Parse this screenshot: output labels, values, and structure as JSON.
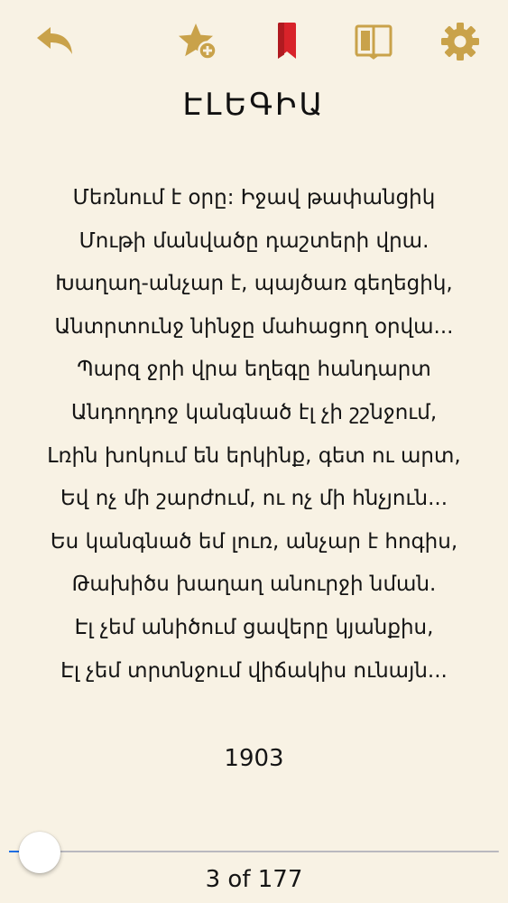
{
  "colors": {
    "background": "#f8f2e4",
    "icon_gold": "#c9a24a",
    "bookmark_red": "#d8232a",
    "slider_fill": "#1f6fe5"
  },
  "toolbar": {
    "icons": [
      "back-arrow-icon",
      "star-add-icon",
      "bookmark-icon",
      "book-icon",
      "gear-icon"
    ]
  },
  "poem": {
    "title": "ԷԼԵԳԻԱ",
    "lines": [
      "Մեռնում է օրը: Իջավ թափանցիկ",
      "Մութի մանվածը դաշտերի վրա.",
      "Խաղաղ-անչար է, պայծառ գեղեցիկ,",
      "Անտրտունջ նինջը մահացող օրվա...",
      "Պարզ ջրի վրա եղեգը հանդարտ",
      "Անդողդոջ կանգնած էլ չի շշնջում,",
      "Լռին խոկում են երկինք, գետ ու արտ,",
      "Եվ ոչ մի շարժում, ու ոչ մի հնչյուն...",
      "Ես կանգնած եմ լուռ, անչար է հոգիս,",
      "Թախիծս խաղաղ անուրջի նման.",
      "Էլ չեմ անիծում ցավերը կյանքիս,",
      "Էլ չեմ տրտնջում վիճակիս ունայն..."
    ],
    "year": "1903"
  },
  "pagination": {
    "current": 3,
    "total": 177,
    "label": "3 of 177"
  }
}
